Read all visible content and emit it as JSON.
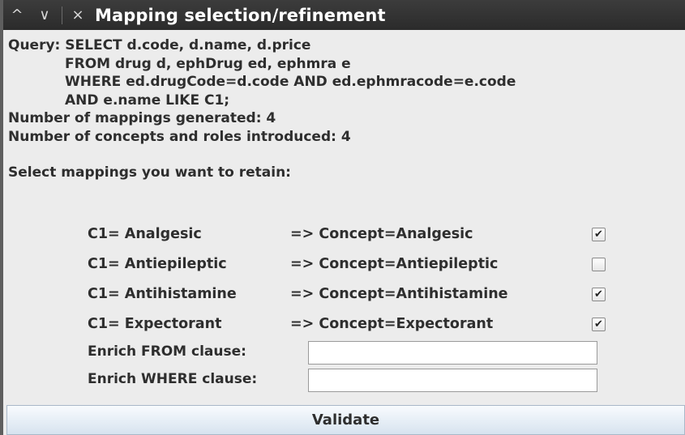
{
  "window": {
    "title": "Mapping selection/refinement",
    "controls": {
      "up": "^",
      "down": "∨",
      "close": "×"
    }
  },
  "query": {
    "lines": [
      "Query: SELECT d.code, d.name, d.price",
      "FROM drug d, ephDrug ed, ephmra e",
      "WHERE ed.drugCode=d.code AND ed.ephmracode=e.code",
      "AND e.name LIKE C1;"
    ]
  },
  "stats": {
    "mappings": "Number of mappings generated: 4",
    "concepts": "Number of concepts and roles introduced: 4"
  },
  "prompt": "Select mappings you want to retain:",
  "mappings": [
    {
      "lhs": "C1= Analgesic",
      "rhs": "=> Concept=Analgesic",
      "checked": true,
      "mark": "✔"
    },
    {
      "lhs": "C1= Antiepileptic",
      "rhs": "=> Concept=Antiepileptic",
      "checked": false,
      "mark": ""
    },
    {
      "lhs": "C1= Antihistamine",
      "rhs": "=> Concept=Antihistamine",
      "checked": true,
      "mark": "✔"
    },
    {
      "lhs": "C1= Expectorant",
      "rhs": "=> Concept=Expectorant",
      "checked": true,
      "mark": "✔"
    }
  ],
  "enrich": {
    "from_label": "Enrich FROM clause:",
    "from_value": "",
    "where_label": "Enrich WHERE clause:",
    "where_value": ""
  },
  "validate_label": "Validate"
}
